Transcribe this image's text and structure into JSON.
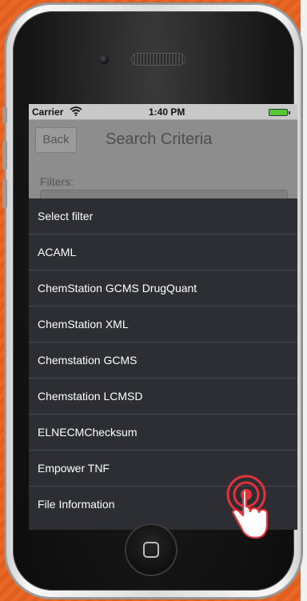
{
  "status_bar": {
    "carrier": "Carrier",
    "time": "1:40 PM"
  },
  "nav_bar": {
    "back_label": "Back",
    "title": "Search Criteria"
  },
  "content": {
    "filters_label": "Filters:"
  },
  "picker": {
    "items": [
      {
        "label": "Select filter"
      },
      {
        "label": "ACAML"
      },
      {
        "label": "ChemStation GCMS DrugQuant"
      },
      {
        "label": "ChemStation XML"
      },
      {
        "label": "Chemstation GCMS"
      },
      {
        "label": "Chemstation LCMSD"
      },
      {
        "label": "ELNECMChecksum"
      },
      {
        "label": "Empower TNF"
      },
      {
        "label": "File Information"
      }
    ]
  },
  "colors": {
    "background": "#e8621f",
    "picker_background": "#2d2e33",
    "nav_background": "#8d8d8d",
    "tap_indicator": "#e2323a"
  }
}
